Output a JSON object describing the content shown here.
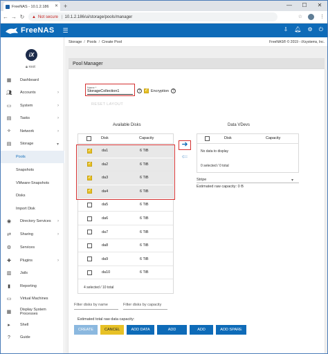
{
  "browser": {
    "tab_title": "FreeNAS - 10.1.2.186",
    "not_secure": "Not secure",
    "url": "10.1.2.186/ui/storage/pools/manager",
    "tab_close": "✕",
    "new_tab": "+",
    "min": "—",
    "max": "☐",
    "close": "✕"
  },
  "app": {
    "logo_text": "FreeNAS",
    "user": "root",
    "ix_label": "iX"
  },
  "sidebar": {
    "items": [
      {
        "label": "Dashboard",
        "icon": "dashboard-icon"
      },
      {
        "label": "Accounts",
        "icon": "accounts-icon"
      },
      {
        "label": "System",
        "icon": "system-icon"
      },
      {
        "label": "Tasks",
        "icon": "tasks-icon"
      },
      {
        "label": "Network",
        "icon": "network-icon"
      },
      {
        "label": "Storage",
        "icon": "storage-icon"
      },
      {
        "label": "Pools"
      },
      {
        "label": "Snapshots"
      },
      {
        "label": "VMware-Snapshots"
      },
      {
        "label": "Disks"
      },
      {
        "label": "Import Disk"
      },
      {
        "label": "Directory Services",
        "icon": "directory-icon"
      },
      {
        "label": "Sharing",
        "icon": "sharing-icon"
      },
      {
        "label": "Services",
        "icon": "services-icon"
      },
      {
        "label": "Plugins",
        "icon": "plugins-icon"
      },
      {
        "label": "Jails",
        "icon": "jails-icon"
      },
      {
        "label": "Reporting",
        "icon": "reporting-icon"
      },
      {
        "label": "Virtual Machines",
        "icon": "vm-icon"
      },
      {
        "label": "Display System Processes",
        "icon": "processes-icon"
      },
      {
        "label": "Shell",
        "icon": "shell-icon"
      },
      {
        "label": "Guide",
        "icon": "guide-icon"
      }
    ]
  },
  "breadcrumb": [
    "Storage",
    "Pools",
    "Create Pool"
  ],
  "copyright": "FreeNAS® © 2019 - iXsystems, Inc.",
  "pool_manager": {
    "title": "Pool Manager",
    "name_label": "Name *",
    "name_value": "StorageCollection1",
    "encryption_label": "Encryption",
    "reset_layout": "RESET LAYOUT",
    "available_title": "Available Disks",
    "data_vdevs_title": "Data VDevs",
    "col_disk": "Disk",
    "col_capacity": "Capacity",
    "disks": [
      {
        "name": "da1",
        "capacity": "6 TiB",
        "checked": true
      },
      {
        "name": "da2",
        "capacity": "6 TiB",
        "checked": true
      },
      {
        "name": "da3",
        "capacity": "6 TiB",
        "checked": true
      },
      {
        "name": "da4",
        "capacity": "6 TiB",
        "checked": true
      },
      {
        "name": "da5",
        "capacity": "6 TiB",
        "checked": false
      },
      {
        "name": "da6",
        "capacity": "6 TiB",
        "checked": false
      },
      {
        "name": "da7",
        "capacity": "6 TiB",
        "checked": false
      },
      {
        "name": "da8",
        "capacity": "6 TiB",
        "checked": false
      },
      {
        "name": "da9",
        "capacity": "6 TiB",
        "checked": false
      },
      {
        "name": "da10",
        "capacity": "6 TiB",
        "checked": false
      }
    ],
    "available_footer": "4 selected / 10 total",
    "vdev_empty": "No data to display",
    "vdev_footer": "0 selected / 0 total",
    "stripe": "Stripe",
    "raw_capacity": "Estimated raw capacity: 0 B",
    "filter_name": "Filter disks by name",
    "filter_capacity": "Filter disks by capacity",
    "estimated_total": "Estimated total raw data capacity:",
    "buttons": {
      "create": "CREATE",
      "cancel": "CANCEL",
      "add_data": "ADD DATA",
      "add_cache": "ADD CACHE",
      "add_log": "ADD LOG",
      "add_spare": "ADD SPARE"
    }
  },
  "colors": {
    "brand": "#0e6bb8",
    "accent_yellow": "#e7c126",
    "highlight_red": "#d32f2f"
  }
}
